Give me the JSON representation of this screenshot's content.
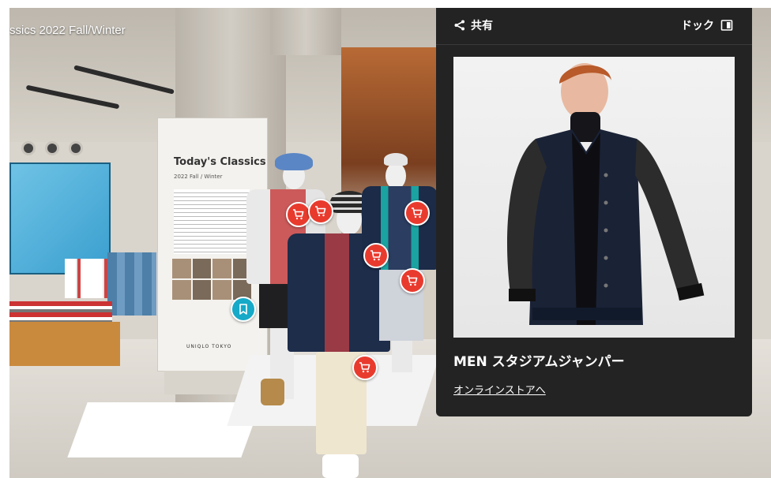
{
  "view": {
    "title": "ssics 2022 Fall/Winter"
  },
  "poster": {
    "title": "Today's Classics",
    "subtitle": "2022 Fall / Winter",
    "logo_text": "UNIQLO TOKYO"
  },
  "panel": {
    "share_label": "共有",
    "dock_label": "ドック",
    "product_name": "MEN スタジアムジャンパー",
    "store_link": "オンラインストアへ"
  },
  "icons": {
    "share": "share-icon",
    "dock": "dock-icon",
    "cart": "cart-icon",
    "bookmark": "bookmark-icon"
  },
  "colors": {
    "panel_bg": "#232323",
    "hotspot_red": "#e83b2e",
    "hotspot_teal": "#16a9c8"
  }
}
